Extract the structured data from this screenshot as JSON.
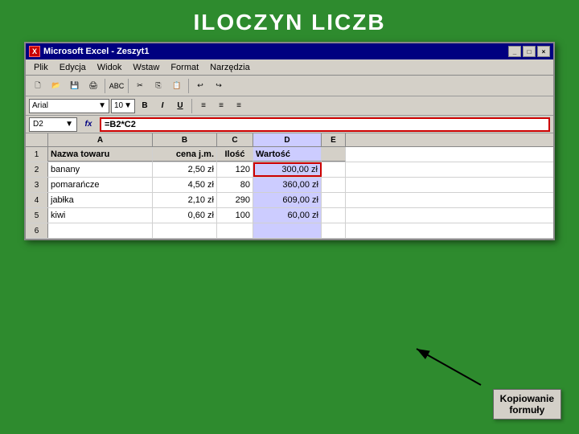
{
  "page": {
    "title": "ILOCZYN LICZB",
    "background": "#2e8b2e"
  },
  "titlebar": {
    "icon": "X",
    "title": "Microsoft Excel - Zeszyt1",
    "minimize": "_",
    "maximize": "□",
    "close": "×"
  },
  "menubar": {
    "items": [
      "Plik",
      "Edycja",
      "Widok",
      "Wstaw",
      "Format",
      "Narzędzia"
    ]
  },
  "formatbar": {
    "font": "Arial",
    "size": "10",
    "bold": "B",
    "italic": "I",
    "underline": "U"
  },
  "formulabar": {
    "cellref": "D2",
    "fx": "fx",
    "formula": "=B2*C2"
  },
  "spreadsheet": {
    "columns": [
      "A",
      "B",
      "C",
      "D",
      "E"
    ],
    "rows": [
      {
        "rownum": "1",
        "a": "Nazwa towaru",
        "b": "cena j.m.",
        "c": "Ilość",
        "d": "Wartość",
        "e": ""
      },
      {
        "rownum": "2",
        "a": "banany",
        "b": "2,50 zł",
        "c": "120",
        "d": "300,00 zł",
        "e": ""
      },
      {
        "rownum": "3",
        "a": "pomarańcze",
        "b": "4,50 zł",
        "c": "80",
        "d": "360,00 zł",
        "e": ""
      },
      {
        "rownum": "4",
        "a": "jabłka",
        "b": "2,10 zł",
        "c": "290",
        "d": "609,00 zł",
        "e": ""
      },
      {
        "rownum": "5",
        "a": "kiwi",
        "b": "0,60 zł",
        "c": "100",
        "d": "60,00 zł",
        "e": ""
      },
      {
        "rownum": "6",
        "a": "",
        "b": "",
        "c": "",
        "d": "",
        "e": ""
      }
    ]
  },
  "annotation": {
    "line1": "Kopiowanie",
    "line2": "formuły"
  }
}
